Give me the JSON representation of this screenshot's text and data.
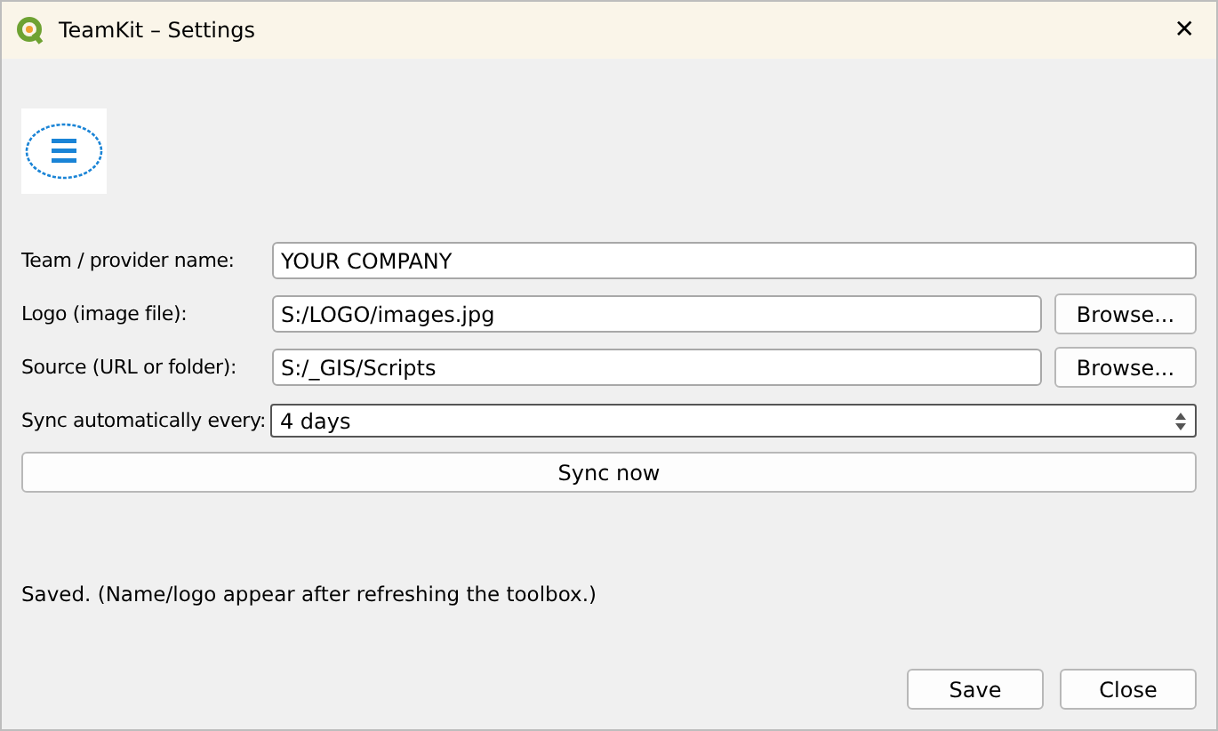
{
  "window": {
    "title": "TeamKit – Settings",
    "close": "✕"
  },
  "fields": [
    {
      "label": "Team / provider name:",
      "value": "YOUR COMPANY",
      "kind": "text"
    },
    {
      "label": "Logo (image file):",
      "value": "S:/LOGO/images.jpg",
      "kind": "browse",
      "button": "Browse..."
    },
    {
      "label": "Source (URL or folder):",
      "value": "S:/_GIS/Scripts",
      "kind": "browse",
      "button": "Browse..."
    },
    {
      "label": "Sync automatically every:",
      "value": "4 days",
      "kind": "spin"
    }
  ],
  "sync_button": "Sync now",
  "status": "Saved. (Name/logo appear after refreshing the toolbox.)",
  "buttons": [
    "Save",
    "Close"
  ]
}
